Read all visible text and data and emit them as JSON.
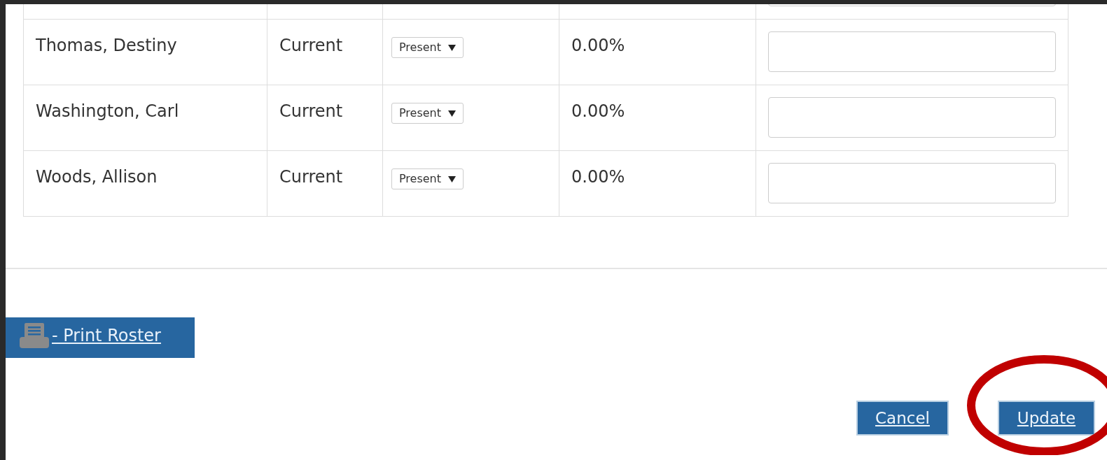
{
  "roster": {
    "rows": [
      {
        "name": "Thomas, Destiny",
        "status": "Current",
        "attendance": "Present",
        "percent": "0.00%"
      },
      {
        "name": "Washington, Carl",
        "status": "Current",
        "attendance": "Present",
        "percent": "0.00%"
      },
      {
        "name": "Woods, Allison",
        "status": "Current",
        "attendance": "Present",
        "percent": "0.00%"
      }
    ]
  },
  "print_button": {
    "label": "- Print Roster"
  },
  "buttons": [
    {
      "label": "Cancel",
      "highlighted": false
    },
    {
      "label": "Update",
      "highlighted": true
    }
  ]
}
